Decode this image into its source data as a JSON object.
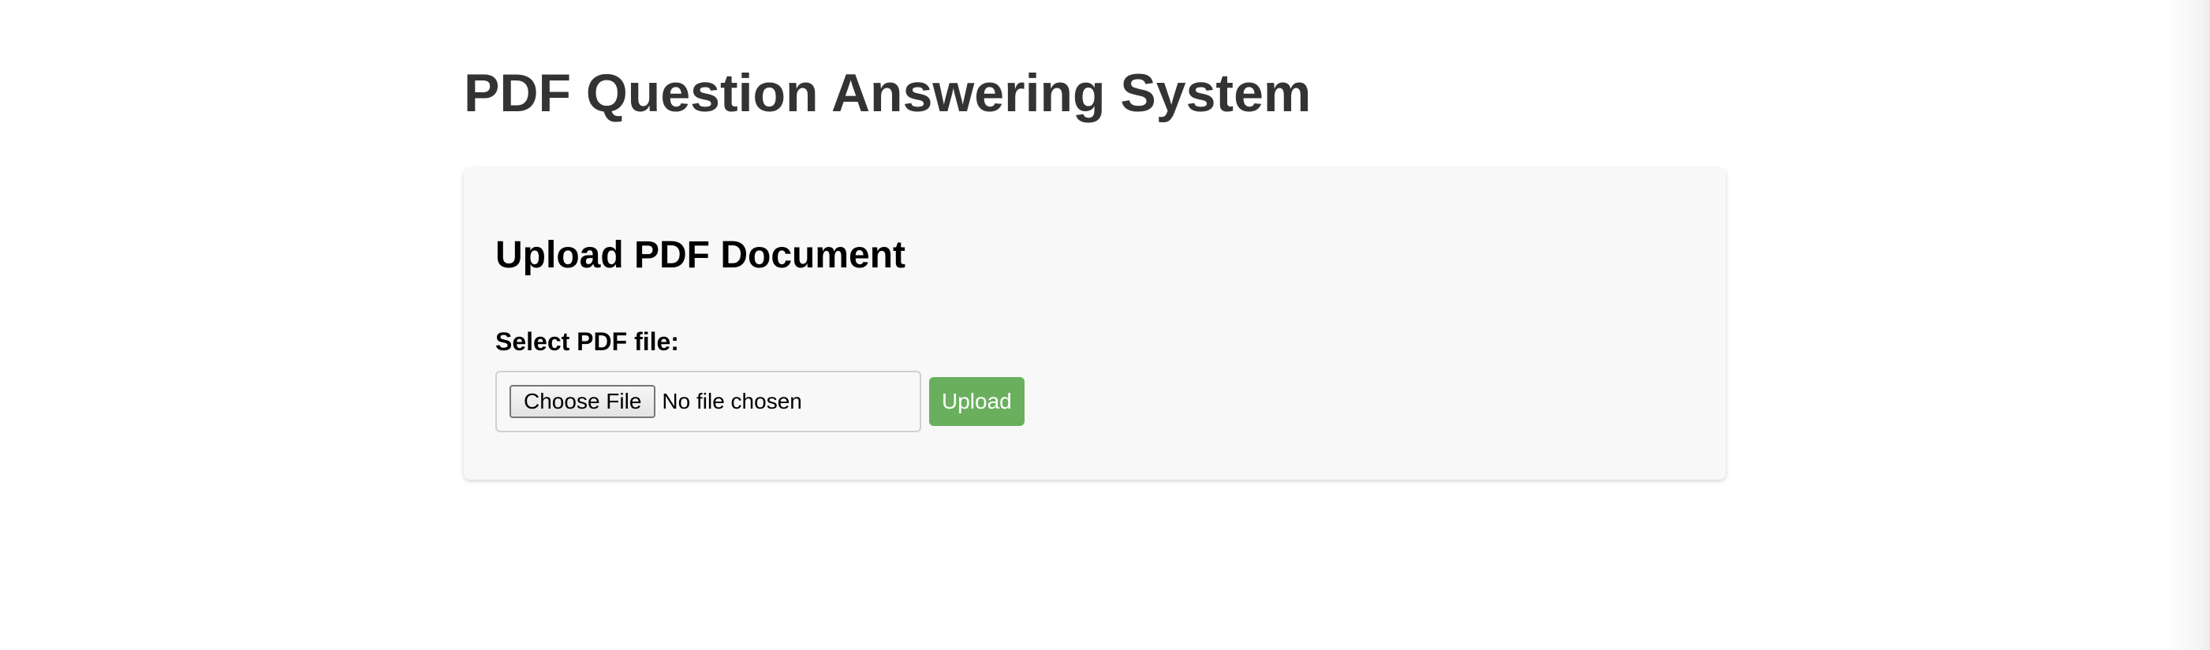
{
  "page": {
    "title": "PDF Question Answering System"
  },
  "upload_section": {
    "heading": "Upload PDF Document",
    "file_label": "Select PDF file:",
    "choose_file_label": "Choose File",
    "file_status": "No file chosen",
    "upload_label": "Upload"
  },
  "colors": {
    "upload_button": "#6aaf5e",
    "title_text": "#333333",
    "card_background": "#f8f8f8"
  }
}
